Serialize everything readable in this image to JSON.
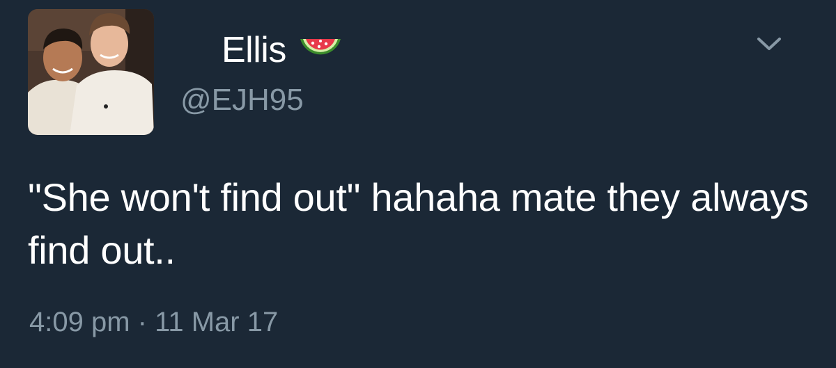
{
  "tweet": {
    "display_name": "Ellis",
    "name_emoji": "watermelon-icon",
    "handle": "@EJH95",
    "text": "\"She won't find out\" hahaha mate they always find out..",
    "timestamp": "4:09 pm · 11 Mar 17",
    "menu_icon": "chevron-down-icon"
  },
  "colors": {
    "background": "#1b2836",
    "primary_text": "#ffffff",
    "secondary_text": "#8899a6"
  }
}
